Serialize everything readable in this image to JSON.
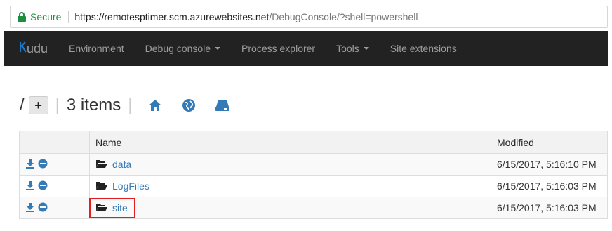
{
  "browser": {
    "secure_label": "Secure",
    "url_host": "https://remotesptimer.scm.azurewebsites.net",
    "url_path": "/DebugConsole/?shell=powershell"
  },
  "navbar": {
    "brand": "udu",
    "items": [
      {
        "label": "Environment"
      },
      {
        "label": "Debug console"
      },
      {
        "label": "Process explorer"
      },
      {
        "label": "Tools"
      },
      {
        "label": "Site extensions"
      }
    ]
  },
  "toolbar": {
    "path": "/",
    "add_label": "+",
    "items_count": "3 items",
    "icons": [
      "home-icon",
      "globe-icon",
      "drive-icon"
    ]
  },
  "table": {
    "headers": [
      "",
      "Name",
      "Modified"
    ],
    "rows": [
      {
        "name": "data",
        "modified": "6/15/2017, 5:16:10 PM"
      },
      {
        "name": "LogFiles",
        "modified": "6/15/2017, 5:16:03 PM"
      },
      {
        "name": "site",
        "modified": "6/15/2017, 5:16:03 PM"
      }
    ]
  },
  "colors": {
    "navbar_bg": "#222222",
    "link": "#337ab7",
    "secure": "#1e8e3e",
    "highlight": "#e02020",
    "icon_blue": "#337ab7"
  }
}
